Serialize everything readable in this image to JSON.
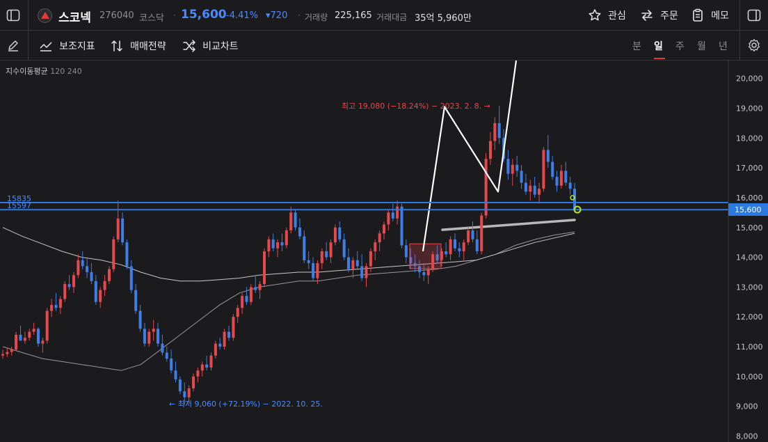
{
  "header": {
    "name": "스코넥",
    "code": "276040",
    "market": "코스닥",
    "price": "15,600",
    "change_rate": "-4.41%",
    "change": "▾720",
    "volume_label": "거래량",
    "volume": "225,165",
    "amount_label": "거래대금",
    "amount": "35억 5,960만",
    "watch_label": "관심",
    "order_label": "주문",
    "memo_label": "메모"
  },
  "toolbar": {
    "indicator_label": "보조지표",
    "strategy_label": "매매전략",
    "compare_label": "비교차트",
    "periods": [
      "분",
      "일",
      "주",
      "월",
      "년"
    ],
    "active_period": "일"
  },
  "chart_data": {
    "type": "candlestick",
    "indicator_legend": {
      "name": "지수이동평균",
      "params": "120 240"
    },
    "ylim": [
      7800,
      20600
    ],
    "y_ticks": [
      "8,000",
      "9,000",
      "10,000",
      "11,000",
      "12,000",
      "13,000",
      "14,000",
      "15,000",
      "16,000",
      "17,000",
      "18,000",
      "19,000",
      "20,000"
    ],
    "current_price_label": "15,600",
    "colors": {
      "up": "#e5484d",
      "down": "#3d7fe6",
      "hline": "#2a7ae2",
      "ma1": "#9a9a9a",
      "ma2": "#c8c8c8"
    },
    "horizontal_lines": [
      {
        "label": "15835",
        "value": 15835
      },
      {
        "label": "15597",
        "value": 15597
      }
    ],
    "annotations": {
      "high": "최고 19,080 (−18.24%) − 2023. 2. 8.",
      "low": "최저 9,060 (+72.19%) − 2022. 10. 25."
    },
    "candles": [
      [
        10700,
        10900,
        10600,
        10750
      ],
      [
        10750,
        10950,
        10650,
        10820
      ],
      [
        10820,
        11000,
        10700,
        10900
      ],
      [
        10900,
        11500,
        10850,
        11400
      ],
      [
        11400,
        11700,
        11300,
        11200
      ],
      [
        11200,
        11500,
        11100,
        11300
      ],
      [
        11300,
        11600,
        11200,
        11500
      ],
      [
        11500,
        11800,
        11400,
        11600
      ],
      [
        11600,
        11650,
        11000,
        11100
      ],
      [
        11100,
        11300,
        10800,
        11200
      ],
      [
        11200,
        12300,
        11100,
        12200
      ],
      [
        12200,
        12600,
        12000,
        12400
      ],
      [
        12400,
        12800,
        12200,
        12300
      ],
      [
        12300,
        12700,
        12100,
        12600
      ],
      [
        12600,
        13200,
        12500,
        13100
      ],
      [
        13100,
        13400,
        12900,
        13000
      ],
      [
        13000,
        13500,
        12800,
        13400
      ],
      [
        13400,
        14100,
        13300,
        13900
      ],
      [
        13900,
        14200,
        13600,
        13700
      ],
      [
        13700,
        14000,
        13300,
        13500
      ],
      [
        13500,
        13800,
        13100,
        13200
      ],
      [
        13200,
        13400,
        12400,
        12500
      ],
      [
        12500,
        13000,
        12300,
        12900
      ],
      [
        12900,
        13400,
        12700,
        13200
      ],
      [
        13200,
        13700,
        13100,
        13600
      ],
      [
        13600,
        14700,
        13500,
        14600
      ],
      [
        14600,
        15900,
        14500,
        15300
      ],
      [
        15300,
        15500,
        14400,
        14500
      ],
      [
        14500,
        14600,
        13600,
        13700
      ],
      [
        13700,
        13900,
        12800,
        12900
      ],
      [
        12900,
        13100,
        12100,
        12200
      ],
      [
        12200,
        12400,
        11500,
        11600
      ],
      [
        11600,
        11800,
        11000,
        11100
      ],
      [
        11100,
        11600,
        11000,
        11500
      ],
      [
        11500,
        11900,
        11200,
        11600
      ],
      [
        11600,
        11800,
        11000,
        11100
      ],
      [
        11100,
        11400,
        10700,
        10800
      ],
      [
        10800,
        11000,
        10500,
        10600
      ],
      [
        10600,
        10900,
        10100,
        10200
      ],
      [
        10200,
        10500,
        9800,
        9900
      ],
      [
        9900,
        10000,
        9400,
        9500
      ],
      [
        9500,
        9800,
        9060,
        9300
      ],
      [
        9300,
        9700,
        9100,
        9600
      ],
      [
        9600,
        10100,
        9500,
        10000
      ],
      [
        10000,
        10300,
        9800,
        10200
      ],
      [
        10200,
        10500,
        10000,
        10400
      ],
      [
        10400,
        10700,
        10200,
        10300
      ],
      [
        10300,
        10800,
        10200,
        10700
      ],
      [
        10700,
        11200,
        10600,
        11100
      ],
      [
        11100,
        11300,
        10900,
        11000
      ],
      [
        11000,
        11600,
        10900,
        11500
      ],
      [
        11500,
        11700,
        11200,
        11300
      ],
      [
        11300,
        12100,
        11200,
        12000
      ],
      [
        12000,
        12400,
        11800,
        12300
      ],
      [
        12300,
        12800,
        12100,
        12700
      ],
      [
        12700,
        13000,
        12400,
        12500
      ],
      [
        12500,
        13100,
        12400,
        13000
      ],
      [
        13000,
        13400,
        12800,
        12900
      ],
      [
        12900,
        13200,
        12600,
        13100
      ],
      [
        13100,
        14300,
        13000,
        14200
      ],
      [
        14200,
        14700,
        14000,
        14600
      ],
      [
        14600,
        14800,
        14200,
        14300
      ],
      [
        14300,
        14600,
        14000,
        14500
      ],
      [
        14500,
        14800,
        14200,
        14400
      ],
      [
        14400,
        15000,
        14300,
        14900
      ],
      [
        14900,
        15700,
        14800,
        15500
      ],
      [
        15500,
        15600,
        14900,
        15000
      ],
      [
        15000,
        15300,
        14600,
        14700
      ],
      [
        14700,
        14900,
        13800,
        13900
      ],
      [
        13900,
        14200,
        13600,
        13800
      ],
      [
        13800,
        14000,
        13200,
        13300
      ],
      [
        13300,
        13900,
        13100,
        13800
      ],
      [
        13800,
        14300,
        13600,
        14200
      ],
      [
        14200,
        14500,
        13900,
        14000
      ],
      [
        14000,
        14600,
        13800,
        14500
      ],
      [
        14500,
        15100,
        14400,
        15000
      ],
      [
        15000,
        15200,
        14500,
        14600
      ],
      [
        14600,
        14800,
        13900,
        14000
      ],
      [
        14000,
        14300,
        13500,
        13600
      ],
      [
        13600,
        14000,
        13300,
        13900
      ],
      [
        13900,
        14200,
        13600,
        13700
      ],
      [
        13700,
        14100,
        13200,
        13300
      ],
      [
        13300,
        13800,
        13000,
        13700
      ],
      [
        13700,
        14300,
        13500,
        14200
      ],
      [
        14200,
        14600,
        13900,
        14500
      ],
      [
        14500,
        14900,
        14200,
        14800
      ],
      [
        14800,
        15200,
        14600,
        15100
      ],
      [
        15100,
        15600,
        14900,
        15500
      ],
      [
        15500,
        15800,
        15200,
        15300
      ],
      [
        15300,
        15900,
        15100,
        15700
      ],
      [
        15700,
        15800,
        14300,
        14400
      ],
      [
        14400,
        14600,
        13800,
        14000
      ],
      [
        14000,
        14300,
        13600,
        13800
      ],
      [
        13800,
        14100,
        13500,
        13700
      ],
      [
        13700,
        13900,
        13300,
        13500
      ],
      [
        13500,
        13800,
        13200,
        13400
      ],
      [
        13400,
        13700,
        13100,
        13600
      ],
      [
        13600,
        14200,
        13500,
        14100
      ],
      [
        14100,
        14400,
        13800,
        13900
      ],
      [
        13900,
        14300,
        13700,
        14200
      ],
      [
        14200,
        14500,
        14000,
        14100
      ],
      [
        14100,
        14700,
        13900,
        14600
      ],
      [
        14600,
        14800,
        14200,
        14300
      ],
      [
        14300,
        14500,
        14000,
        14200
      ],
      [
        14200,
        14600,
        13900,
        14500
      ],
      [
        14500,
        15000,
        14400,
        14900
      ],
      [
        14900,
        15200,
        14500,
        14600
      ],
      [
        14600,
        14900,
        14100,
        14200
      ],
      [
        14200,
        15500,
        14100,
        15400
      ],
      [
        15400,
        17500,
        15300,
        17300
      ],
      [
        17300,
        18200,
        17100,
        17900
      ],
      [
        17900,
        18700,
        17600,
        18500
      ],
      [
        18500,
        19080,
        17800,
        18000
      ],
      [
        18000,
        18300,
        17200,
        17300
      ],
      [
        17300,
        17600,
        16600,
        16800
      ],
      [
        16800,
        17300,
        16400,
        17100
      ],
      [
        17100,
        17400,
        16700,
        16900
      ],
      [
        16900,
        17100,
        16300,
        16500
      ],
      [
        16500,
        16800,
        16100,
        16200
      ],
      [
        16200,
        16600,
        15900,
        16400
      ],
      [
        16400,
        16700,
        16000,
        16100
      ],
      [
        16100,
        16500,
        15800,
        16300
      ],
      [
        16300,
        17700,
        16200,
        17600
      ],
      [
        17600,
        18100,
        17000,
        17200
      ],
      [
        17200,
        17400,
        16600,
        16700
      ],
      [
        16700,
        16900,
        16200,
        16400
      ],
      [
        16400,
        17100,
        16300,
        16900
      ],
      [
        16900,
        17200,
        16400,
        16500
      ],
      [
        16500,
        16700,
        16100,
        16300
      ],
      [
        16300,
        16500,
        15600,
        15600
      ]
    ],
    "ma_series": [
      {
        "name": "EMA120",
        "values": [
          11000,
          10800,
          10600,
          10500,
          10400,
          10300,
          10200,
          10400,
          10900,
          11400,
          11900,
          12400,
          12800,
          13000,
          13100,
          13200,
          13200,
          13300,
          13400,
          13450,
          13500,
          13550,
          13600,
          13700,
          13900,
          14100,
          14400,
          14600,
          14750,
          14850
        ]
      },
      {
        "name": "EMA240",
        "values": [
          15000,
          14700,
          14450,
          14200,
          14000,
          13900,
          13750,
          13500,
          13300,
          13200,
          13200,
          13250,
          13300,
          13400,
          13450,
          13500,
          13500,
          13550,
          13600,
          13650,
          13700,
          13750,
          13800,
          13850,
          13900,
          14100,
          14300,
          14500,
          14650,
          14800
        ]
      }
    ]
  }
}
